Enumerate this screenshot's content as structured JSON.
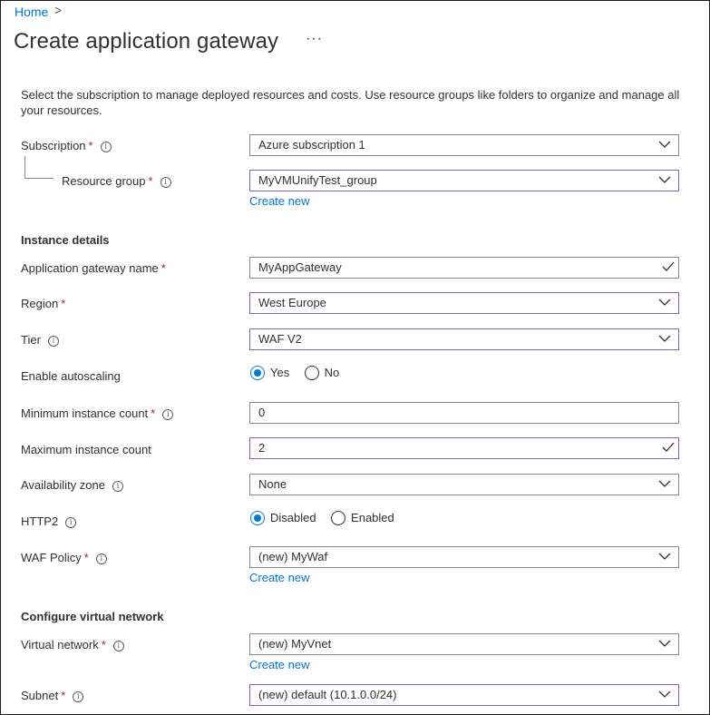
{
  "breadcrumb": {
    "home": "Home",
    "separator": ">"
  },
  "page": {
    "title": "Create application gateway",
    "more": "···"
  },
  "description": "Select the subscription to manage deployed resources and costs. Use resource groups like folders to organize and manage all your resources.",
  "subscription": {
    "label": "Subscription",
    "value": "Azure subscription 1"
  },
  "resource_group": {
    "label": "Resource group",
    "value": "MyVMUnifyTest_group",
    "create_new": "Create new"
  },
  "instance_details": {
    "heading": "Instance details",
    "gateway_name": {
      "label": "Application gateway name",
      "value": "MyAppGateway"
    },
    "region": {
      "label": "Region",
      "value": "West Europe"
    },
    "tier": {
      "label": "Tier",
      "value": "WAF V2"
    },
    "autoscaling": {
      "label": "Enable autoscaling",
      "yes": "Yes",
      "no": "No",
      "selected": "Yes"
    },
    "min_count": {
      "label": "Minimum instance count",
      "value": "0"
    },
    "max_count": {
      "label": "Maximum instance count",
      "value": "2"
    },
    "availability_zone": {
      "label": "Availability zone",
      "value": "None"
    },
    "http2": {
      "label": "HTTP2",
      "disabled": "Disabled",
      "enabled": "Enabled",
      "selected": "Disabled"
    },
    "waf_policy": {
      "label": "WAF Policy",
      "value": "(new) MyWaf",
      "create_new": "Create new"
    }
  },
  "vnet": {
    "heading": "Configure virtual network",
    "virtual_network": {
      "label": "Virtual network",
      "value": "(new) MyVnet",
      "create_new": "Create new"
    },
    "subnet": {
      "label": "Subnet",
      "value": "(new) default (10.1.0.0/24)"
    }
  },
  "required_marker": "*",
  "info_glyph": "i",
  "colors": {
    "link": "#0078d4",
    "required": "#a4262c",
    "focus_border": "#8661c5",
    "border": "#8a8886"
  }
}
